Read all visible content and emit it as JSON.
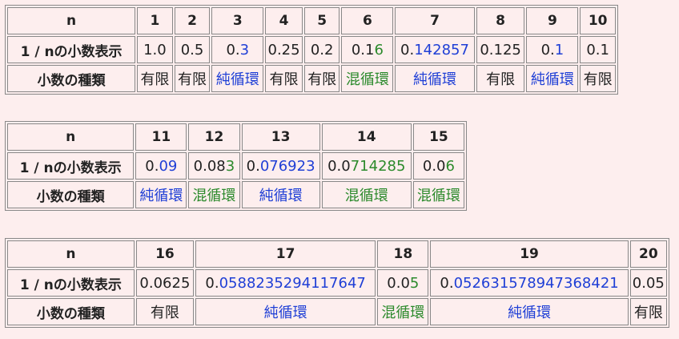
{
  "row_labels": {
    "n": "n",
    "decimal": "1 / nの小数表示",
    "type": "小数の種類"
  },
  "tables": [
    {
      "columns": [
        {
          "n": "1",
          "prefix": "1.0",
          "rep": "",
          "type": "有限",
          "color": ""
        },
        {
          "n": "2",
          "prefix": "0.5",
          "rep": "",
          "type": "有限",
          "color": ""
        },
        {
          "n": "3",
          "prefix": "0.",
          "rep": "3",
          "type": "純循環",
          "color": "b"
        },
        {
          "n": "4",
          "prefix": "0.25",
          "rep": "",
          "type": "有限",
          "color": ""
        },
        {
          "n": "5",
          "prefix": "0.2",
          "rep": "",
          "type": "有限",
          "color": ""
        },
        {
          "n": "6",
          "prefix": "0.1",
          "rep": "6",
          "type": "混循環",
          "color": "g"
        },
        {
          "n": "7",
          "prefix": "0.",
          "rep": "142857",
          "type": "純循環",
          "color": "b"
        },
        {
          "n": "8",
          "prefix": "0.125",
          "rep": "",
          "type": "有限",
          "color": ""
        },
        {
          "n": "9",
          "prefix": "0.",
          "rep": "1",
          "type": "純循環",
          "color": "b"
        },
        {
          "n": "10",
          "prefix": "0.1",
          "rep": "",
          "type": "有限",
          "color": ""
        }
      ]
    },
    {
      "columns": [
        {
          "n": "11",
          "prefix": "0.",
          "rep": "09",
          "type": "純循環",
          "color": "b"
        },
        {
          "n": "12",
          "prefix": "0.08",
          "rep": "3",
          "type": "混循環",
          "color": "g"
        },
        {
          "n": "13",
          "prefix": "0.",
          "rep": "076923",
          "type": "純循環",
          "color": "b"
        },
        {
          "n": "14",
          "prefix": "0.0",
          "rep": "714285",
          "type": "混循環",
          "color": "g"
        },
        {
          "n": "15",
          "prefix": "0.0",
          "rep": "6",
          "type": "混循環",
          "color": "g"
        }
      ]
    },
    {
      "columns": [
        {
          "n": "16",
          "prefix": "0.0625",
          "rep": "",
          "type": "有限",
          "color": ""
        },
        {
          "n": "17",
          "prefix": "0.",
          "rep": "0588235294117647",
          "type": "純循環",
          "color": "b"
        },
        {
          "n": "18",
          "prefix": "0.0",
          "rep": "5",
          "type": "混循環",
          "color": "g"
        },
        {
          "n": "19",
          "prefix": "0.",
          "rep": "052631578947368421",
          "type": "純循環",
          "color": "b"
        },
        {
          "n": "20",
          "prefix": "0.05",
          "rep": "",
          "type": "有限",
          "color": ""
        }
      ]
    }
  ]
}
